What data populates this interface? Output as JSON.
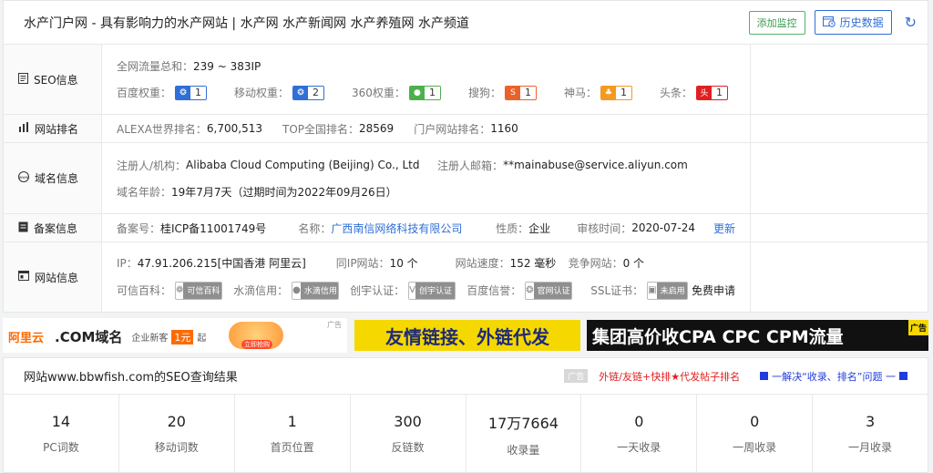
{
  "header": {
    "title": "水产门户网 - 具有影响力的水产网站 | 水产网 水产新闻网 水产养殖网 水产频道",
    "add_monitor": "添加监控",
    "history": "历史数据"
  },
  "seo": {
    "label": "SEO信息",
    "traffic_k": "全网流量总和：",
    "traffic_v": "239 ~ 383IP",
    "weights": [
      {
        "name": "百度权重：",
        "value": "1",
        "color": "#2f6fd6",
        "icon": "paw-icon"
      },
      {
        "name": "移动权重：",
        "value": "2",
        "color": "#2f6fd6",
        "icon": "paw-icon"
      },
      {
        "name": "360权重：",
        "value": "1",
        "color": "#4cb14a",
        "icon": "circle-icon"
      },
      {
        "name": "搜狗：",
        "value": "1",
        "color": "#e8632b",
        "icon": "s-icon"
      },
      {
        "name": "神马：",
        "value": "1",
        "color": "#f39a1f",
        "icon": "horse-icon"
      },
      {
        "name": "头条：",
        "value": "1",
        "color": "#e02020",
        "icon": "toutiao-icon"
      }
    ],
    "toutiao_icon_text": "头条"
  },
  "rank": {
    "label": "网站排名",
    "alexa_k": "ALEXA世界排名：",
    "alexa_v": "6,700,513",
    "top_k": "TOP全国排名：",
    "top_v": "28569",
    "portal_k": "门户网站排名：",
    "portal_v": "1160"
  },
  "domain": {
    "label": "域名信息",
    "reg_k": "注册人/机构：",
    "reg_v": "Alibaba Cloud Computing (Beijing) Co., Ltd",
    "email_k": "注册人邮箱：",
    "email_v": "**mainabuse@service.aliyun.com",
    "age_k": "域名年龄：",
    "age_v": "19年7月7天（过期时间为2022年09月26日）"
  },
  "beian": {
    "label": "备案信息",
    "no_k": "备案号：",
    "no_v": "桂ICP备11001749号",
    "name_k": "名称：",
    "name_v": "广西南信网络科技有限公司",
    "type_k": "性质：",
    "type_v": "企业",
    "date_k": "审核时间：",
    "date_v": "2020-07-24",
    "update": "更新"
  },
  "site": {
    "label": "网站信息",
    "ip_k": "IP：",
    "ip_v": "47.91.206.215[中国香港 阿里云]",
    "sameip_k": "同IP网站：",
    "sameip_v": "10 个",
    "speed_k": "网站速度：",
    "speed_v": "152 毫秒",
    "compete_k": "竞争网站：",
    "compete_v": "0 个",
    "baike_k": "可信百科：",
    "baike_b": "可信百科",
    "shuidi_k": "水滴信用：",
    "shuidi_b": "水滴信用",
    "chuangyu_k": "创宇认证：",
    "chuangyu_b": "创宇认证",
    "baidu_k": "百度信誉：",
    "baidu_b": "官网认证",
    "ssl_k": "SSL证书：",
    "ssl_b": "未启用",
    "ssl_apply": "免费申请"
  },
  "ads": {
    "ad1_logo": "阿里云",
    "ad1_text": ".COM域名",
    "ad1_sub": "企业新客",
    "ad1_price": "1元",
    "ad1_suffix": "起",
    "ad1_btn": "立即抢购",
    "ad1_tag": "广告",
    "ad2": "友情链接、外链代发",
    "ad3": "集团高价收CPA CPC CPM流量",
    "ad3_tag": "广告"
  },
  "result": {
    "title": "网站www.bbwfish.com的SEO查询结果",
    "adtag": "广告",
    "promo_red": "外链/友链+快排★代发帖子排名",
    "promo_blue": "一解决“收录、排名”问题 一",
    "stats": [
      {
        "value": "14",
        "label": "PC词数"
      },
      {
        "value": "20",
        "label": "移动词数"
      },
      {
        "value": "1",
        "label": "首页位置"
      },
      {
        "value": "300",
        "label": "反链数"
      },
      {
        "value": "17万7664",
        "label": "收录量"
      },
      {
        "value": "0",
        "label": "一天收录"
      },
      {
        "value": "0",
        "label": "一周收录"
      },
      {
        "value": "3",
        "label": "一月收录"
      }
    ]
  }
}
